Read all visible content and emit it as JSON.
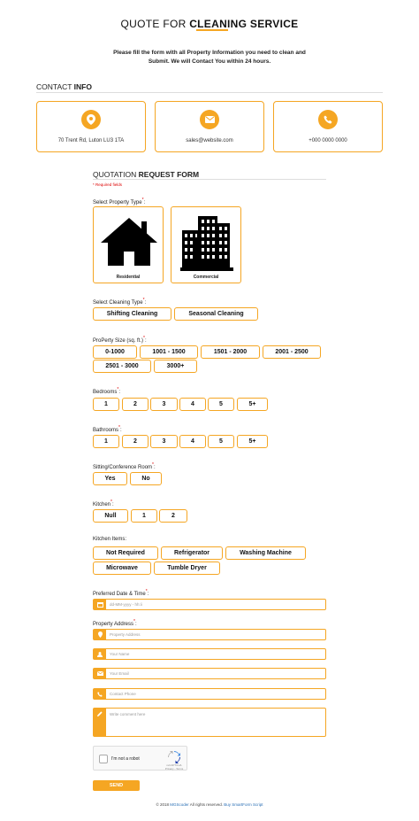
{
  "header": {
    "title_light": "QUOTE FOR ",
    "title_bold": "CLEANING SERVICE",
    "intro_line1": "Please fill the form with all Property Information you need to clean and",
    "intro_line2": "Submit. We will Contact You within 24 hours."
  },
  "contact": {
    "heading_light": "CONTACT ",
    "heading_bold": "INFO",
    "cards": [
      {
        "icon": "location-pin-icon",
        "text": "70 Trent Rd, Luton LU3 1TA"
      },
      {
        "icon": "envelope-icon",
        "text": "sales@website.com"
      },
      {
        "icon": "phone-icon",
        "text": "+000 0000 0000"
      }
    ]
  },
  "form": {
    "heading_light": "QUOTATION ",
    "heading_bold": "REQUEST FORM",
    "required_note": "* Required fields",
    "property_type": {
      "label": "Select Property Type",
      "options": [
        "Residential",
        "Commercial"
      ]
    },
    "cleaning_type": {
      "label": "Select Cleaning Type",
      "options": [
        "Shifting Cleaning",
        "Seasonal Cleaning"
      ]
    },
    "property_size": {
      "label": "ProPerty Size (sq. ft.)",
      "options": [
        "0-1000",
        "1001 - 1500",
        "1501 - 2000",
        "2001 - 2500",
        "2501 - 3000",
        "3000+"
      ]
    },
    "bedrooms": {
      "label": "Bedrooms",
      "options": [
        "1",
        "2",
        "3",
        "4",
        "5",
        "5+"
      ]
    },
    "bathrooms": {
      "label": "Bathrooms",
      "options": [
        "1",
        "2",
        "3",
        "4",
        "5",
        "5+"
      ]
    },
    "sitting_room": {
      "label": "Sitting/Conference Room",
      "options": [
        "Yes",
        "No"
      ]
    },
    "kitchen": {
      "label": "Kitchen",
      "options": [
        "Null",
        "1",
        "2"
      ]
    },
    "kitchen_items": {
      "label": "Kitchen Items:",
      "options": [
        "Not Required",
        "Refrigerator",
        "Washing Machine",
        "Microwave",
        "Tumble Dryer"
      ]
    },
    "date_time": {
      "label": "Preferred Date & Time",
      "placeholder": "dd-MM-yyyy - hh:ii"
    },
    "address": {
      "label": "Property Address",
      "placeholder": "Property Address"
    },
    "name": {
      "placeholder": "Your Name"
    },
    "email": {
      "placeholder": "Your Email"
    },
    "phone": {
      "placeholder": "Contact Phone"
    },
    "comment": {
      "placeholder": "Write comment here"
    },
    "captcha": {
      "text": "I'm not a robot",
      "brand": "reCAPTCHA",
      "links": "Privacy - Terms"
    },
    "submit_label": "SEND"
  },
  "footer": {
    "prefix": "© 2018 ",
    "brand": "MGScoder",
    "middle": " All rights reserved. ",
    "link": "Buy SmartForm Script"
  },
  "colors": {
    "accent": "#f5a623",
    "required": "#dd0000",
    "link": "#2a6fb5"
  }
}
